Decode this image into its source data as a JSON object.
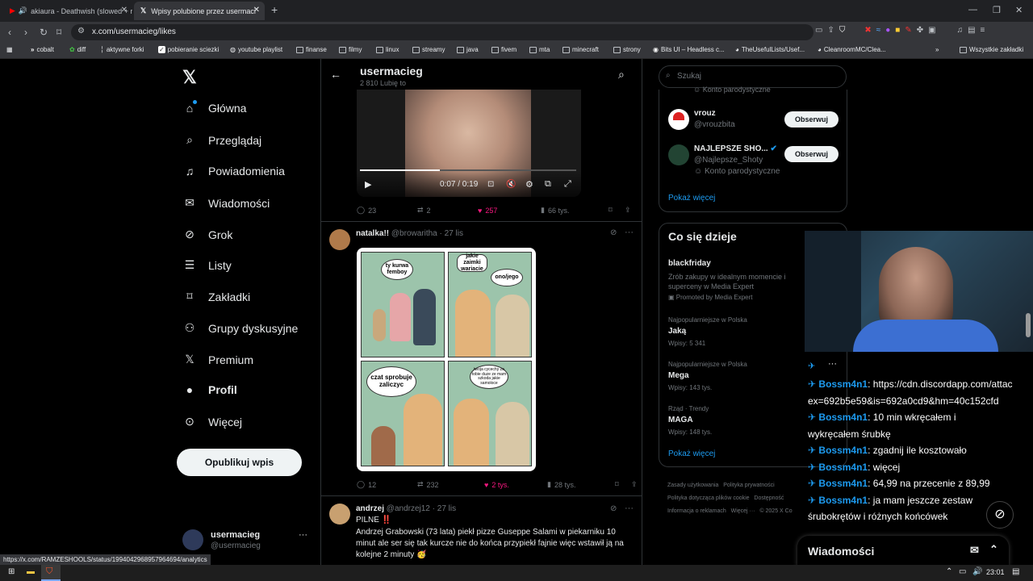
{
  "browser": {
    "tabs": [
      {
        "title": "akiaura - Deathwish (slowed + re"
      },
      {
        "title": "Wpisy polubione przez usermaci"
      }
    ],
    "url": "x.com/usermacieg/likes",
    "bookmarks": [
      "cobalt",
      "diff",
      "aktywne forki",
      "pobieranie sciezki",
      "youtube playlist",
      "finanse",
      "filmy",
      "linux",
      "streamy",
      "java",
      "fivem",
      "mta",
      "minecraft",
      "strony",
      "Bits UI – Headless c...",
      "TheUsefulLists/Usef...",
      "CleanroomMC/Clea..."
    ],
    "bookmarks_overflow": "»",
    "all_bookmarks": "Wszystkie zakładki",
    "status_url": "https://x.com/RAMZESHOOLS/status/1994042968957964694/analytics"
  },
  "nav": {
    "items": [
      "Główna",
      "Przeglądaj",
      "Powiadomienia",
      "Wiadomości",
      "Grok",
      "Listy",
      "Zakładki",
      "Grupy dyskusyjne",
      "Premium",
      "Profil",
      "Więcej"
    ],
    "post_button": "Opublikuj wpis",
    "profile_name": "usermacieg",
    "profile_handle": "@usermacieg"
  },
  "feed": {
    "title": "usermacieg",
    "subtitle": "2 810 Lubię to",
    "video": {
      "time": "0:07 / 0:19",
      "progress": 0.37
    },
    "tweet1_stats": {
      "replies": "23",
      "retweets": "2",
      "likes": "257",
      "views": "66 tys."
    },
    "tweet2": {
      "name": "natalka!!",
      "handle": "@browaritha",
      "date": "27 lis",
      "comic": {
        "b1": "ty kurwa femboy",
        "b2": "jakie zaimki wariacie",
        "b3": "ono/jego",
        "b4": "czat sprobuje zaliczyc",
        "b5": "twoja cycechy za tobie duze ze mam szkoda jakie samoloce"
      },
      "stats": {
        "replies": "12",
        "retweets": "232",
        "likes": "2 tys.",
        "views": "28 tys."
      }
    },
    "tweet3": {
      "name": "andrzej",
      "handle": "@andrzej12",
      "date": "27 lis",
      "line1": "PILNE ‼️",
      "body": "Andrzej Grabowski (73 lata) piekł pizze Guseppe Salami w piekarniku 10 minut ale ser się tak kurcze nie do końca przypiekł fajnie więc wstawił ją na kolejne 2 minuty 🥳"
    }
  },
  "right": {
    "search_placeholder": "Szukaj",
    "parody_label_top": "Konto parodystyczne",
    "suggestions": [
      {
        "name": "vrouz",
        "handle": "@vrouzbita",
        "button": "Obserwuj"
      },
      {
        "name": "NAJLEPSZE SHO...",
        "handle": "@Najlepsze_Shoty",
        "badge": "Konto parodystyczne",
        "button": "Obserwuj"
      }
    ],
    "show_more": "Pokaż więcej",
    "trends_title": "Co się dzieje",
    "promo": {
      "name": "blackfriday",
      "desc": "Zrób zakupy w idealnym momencie i superceny w Media Expert",
      "promoted": "Promoted by Media Expert"
    },
    "trends": [
      {
        "category": "Najpopularniejsze w Polska",
        "name": "Jaką",
        "posts": "Wpisy: 5 341"
      },
      {
        "category": "Najpopularniejsze w Polska",
        "name": "Mega",
        "posts": "Wpisy: 143 tys."
      },
      {
        "category": "Rząd · Trendy",
        "name": "MAGA",
        "posts": "Wpisy: 148 tys."
      }
    ],
    "trends_more": "Pokaż więcej",
    "footer": [
      "Zasady użytkowania",
      "Polityka prywatności",
      "Polityka dotycząca plików cookie",
      "Dostępność",
      "Informacja o reklamach",
      "Więcej ···",
      "© 2025 X Co"
    ]
  },
  "chat": [
    {
      "user": "Bossm4n1",
      "text": "https://cdn.discordapp.com/attac",
      "cont": "ex=692b5e59&is=692a0cd9&hm=40c152cfd"
    },
    {
      "user": "Bossm4n1",
      "text": "10 min wkręcałem i",
      "cont": "wykręcałem śrubkę"
    },
    {
      "user": "Bossm4n1",
      "text": "zgadnij ile kosztowało"
    },
    {
      "user": "Bossm4n1",
      "text": "więcej"
    },
    {
      "user": "Bossm4n1",
      "text": "64,99 na przecenie z 89,99"
    },
    {
      "user": "Bossm4n1",
      "text": "ja mam jeszcze zestaw",
      "cont": "śrubokrętów i różnych końcówek"
    }
  ],
  "messages_dock": "Wiadomości",
  "taskbar": {
    "time": "23:01"
  }
}
